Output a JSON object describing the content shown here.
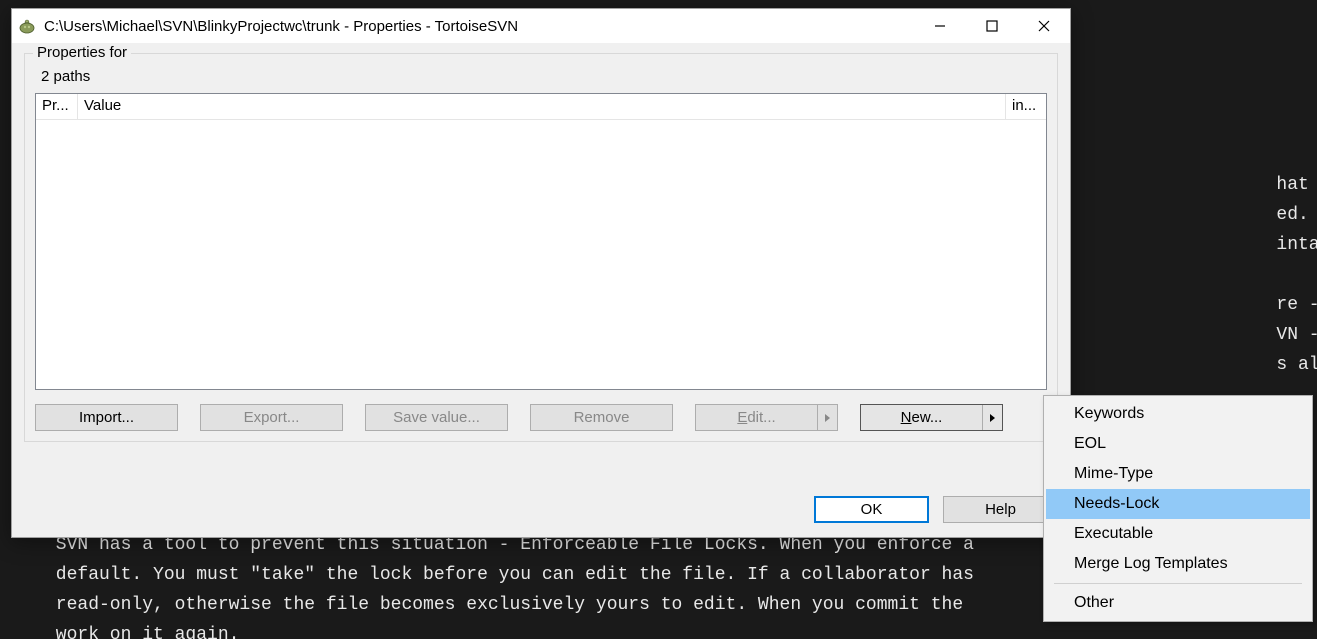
{
  "bg_lines": [
    "                                                                                                                  hat each author made ",
    "                                                                                                                  ed. When two authors ",
    "                                                                                                                  intains each change. ",
    "",
    "                                                                                                                  re - the ability to r",
    "                                                                                                                  VN -> Diff with Previ",
    "                                                                                                                  s almost incomprehens",
    "",
    "",
    "",
    "",
    "",
    " SVN has a tool to prevent this situation - Enforceable File Locks. When you enforce a                              ",
    " default. You must \"take\" the lock before you can edit the file. If a collaborator has ",
    " read-only, otherwise the file becomes exclusively yours to edit. When you commit the ",
    " work on it again."
  ],
  "window": {
    "title": "C:\\Users\\Michael\\SVN\\BlinkyProjectwc\\trunk - Properties - TortoiseSVN",
    "group_legend": "Properties for",
    "paths_label": "2 paths",
    "columns": {
      "c1": "Pr...",
      "c2": "Value",
      "c3": "in..."
    },
    "buttons": {
      "import": "Import...",
      "export": "Export...",
      "save": "Save value...",
      "remove": "Remove",
      "edit_prefix": "E",
      "edit_rest": "dit...",
      "new_prefix": "N",
      "new_rest": "ew...",
      "ok": "OK",
      "help": "Help"
    }
  },
  "menu": {
    "items": [
      "Keywords",
      "EOL",
      "Mime-Type",
      "Needs-Lock",
      "Executable",
      "Merge Log Templates"
    ],
    "other": "Other",
    "highlight_index": 3
  }
}
